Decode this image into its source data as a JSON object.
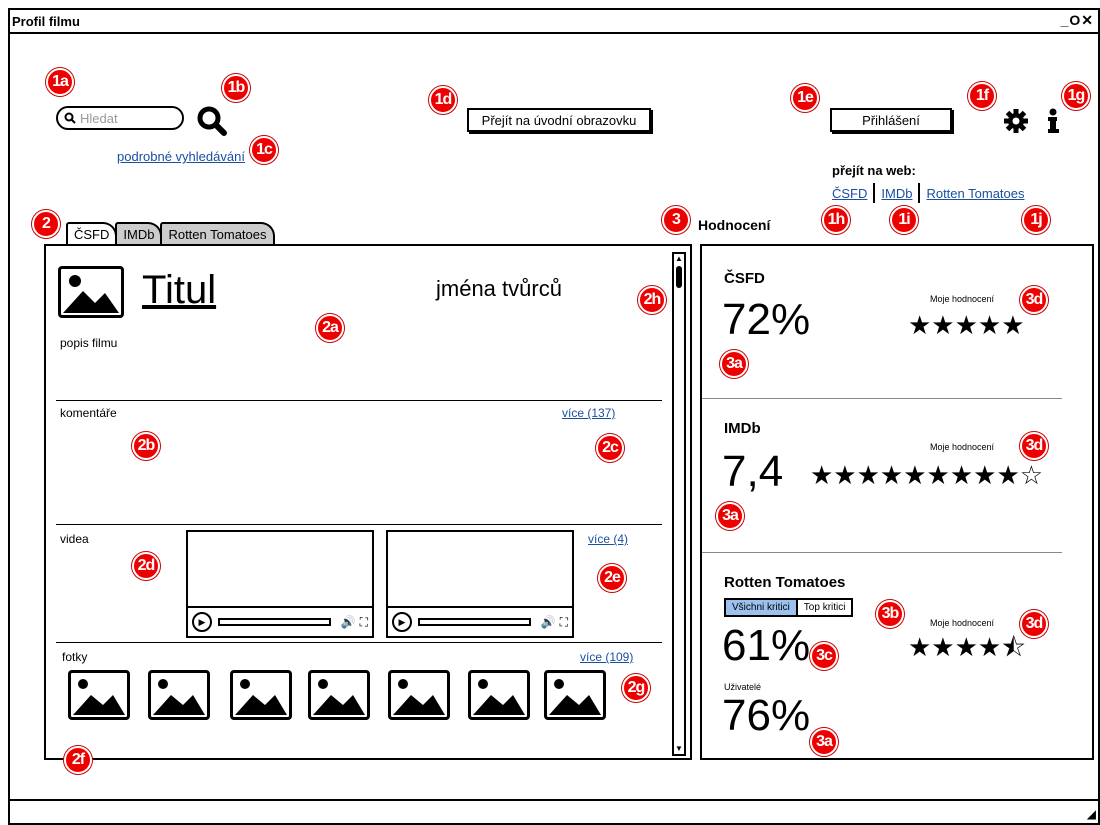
{
  "window": {
    "title": "Profil filmu",
    "controls": "_O✕"
  },
  "header": {
    "search_placeholder": "Hledat",
    "advanced_search": "podrobné vyhledávání",
    "home_button": "Přejít na úvodní obrazovku",
    "login_button": "Přihlášení",
    "goto_web_label": "přejít na web:",
    "links": [
      "ČSFD",
      "IMDb",
      "Rotten Tomatoes"
    ]
  },
  "tabs": [
    "ČSFD",
    "IMDb",
    "Rotten Tomatoes"
  ],
  "film": {
    "title": "Titul",
    "creators": "jména tvůrců",
    "description": "popis filmu",
    "comments_label": "komentáře",
    "comments_more": "více (137)",
    "videos_label": "videa",
    "videos_more": "více (4)",
    "photos_label": "fotky",
    "photos_more": "více (109)"
  },
  "ratings": {
    "heading": "Hodnocení",
    "csfd": {
      "name": "ČSFD",
      "value": "72%",
      "my_label": "Moje hodnocení",
      "stars": "★★★★★"
    },
    "imdb": {
      "name": "IMDb",
      "value": "7,4",
      "my_label": "Moje hodnocení",
      "stars": "★★★★★★★★★☆"
    },
    "rt": {
      "name": "Rotten Tomatoes",
      "toggle_all": "Všichni kritici",
      "toggle_top": "Top kritici",
      "value": "61%",
      "my_label": "Moje hodnocení",
      "stars": "★★★★⯪",
      "users_label": "Uživatelé",
      "users_value": "76%"
    }
  },
  "badges": {
    "b1a": "1a",
    "b1b": "1b",
    "b1c": "1c",
    "b1d": "1d",
    "b1e": "1e",
    "b1f": "1f",
    "b1g": "1g",
    "b1h": "1h",
    "b1i": "1i",
    "b1j": "1j",
    "b2": "2",
    "b2a": "2a",
    "b2b": "2b",
    "b2c": "2c",
    "b2d": "2d",
    "b2e": "2e",
    "b2f": "2f",
    "b2g": "2g",
    "b2h": "2h",
    "b3": "3",
    "b3a": "3a",
    "b3b": "3b",
    "b3c": "3c",
    "b3d": "3d"
  },
  "colors": {
    "badge": "#e00000",
    "link": "#1a4fa0",
    "toggle_active": "#9bc1ee"
  }
}
